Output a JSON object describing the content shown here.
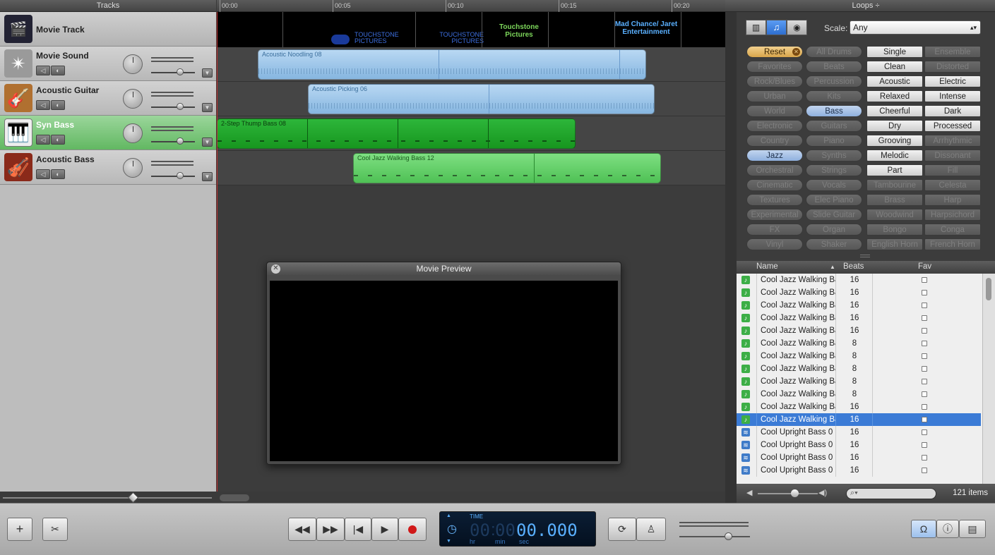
{
  "headers": {
    "tracks": "Tracks",
    "loops": "Loops ÷"
  },
  "ruler": [
    "00:00",
    "00:05",
    "00:10",
    "00:15",
    "00:20"
  ],
  "tracks": [
    {
      "name": "Movie Track",
      "icon": "clapper-icon"
    },
    {
      "name": "Movie Sound",
      "icon": "sound-icon"
    },
    {
      "name": "Acoustic Guitar",
      "icon": "guitar-icon"
    },
    {
      "name": "Syn Bass",
      "icon": "synth-icon"
    },
    {
      "name": "Acoustic Bass",
      "icon": "bass-icon"
    }
  ],
  "movie_frames": [
    "TOUCHSTONE PICTURES",
    "TOUCHSTONE PICTURES",
    "Touchstone Pictures",
    "Mad Chance/ Jaret Entertainment"
  ],
  "regions": [
    {
      "name": "Acoustic Noodling 08"
    },
    {
      "name": "Acoustic Picking 06"
    },
    {
      "name": "2-Step Thump Bass 08"
    },
    {
      "name": "Cool Jazz Walking Bass 12"
    }
  ],
  "preview": {
    "title": "Movie Preview"
  },
  "loops": {
    "scale_label": "Scale:",
    "scale_value": "Any",
    "grid": [
      [
        "Reset",
        "All Drums",
        "Single",
        "Ensemble"
      ],
      [
        "Favorites",
        "Beats",
        "Clean",
        "Distorted"
      ],
      [
        "Rock/Blues",
        "Percussion",
        "Acoustic",
        "Electric"
      ],
      [
        "Urban",
        "Kits",
        "Relaxed",
        "Intense"
      ],
      [
        "World",
        "Bass",
        "Cheerful",
        "Dark"
      ],
      [
        "Electronic",
        "Guitars",
        "Dry",
        "Processed"
      ],
      [
        "Country",
        "Piano",
        "Grooving",
        "Arrhythmic"
      ],
      [
        "Jazz",
        "Synths",
        "Melodic",
        "Dissonant"
      ],
      [
        "Orchestral",
        "Strings",
        "Part",
        "Fill"
      ],
      [
        "Cinematic",
        "Vocals",
        "Tambourine",
        "Celesta"
      ],
      [
        "Textures",
        "Elec Piano",
        "Brass",
        "Harp"
      ],
      [
        "Experimental",
        "Slide Guitar",
        "Woodwind",
        "Harpsichord"
      ],
      [
        "FX",
        "Organ",
        "Bongo",
        "Conga"
      ],
      [
        "Vinyl",
        "Shaker",
        "English Horn",
        "French Horn"
      ]
    ]
  },
  "results": {
    "columns": {
      "name": "Name",
      "beats": "Beats",
      "fav": "Fav"
    },
    "rows": [
      {
        "name": "Cool Jazz Walking Ba",
        "beats": "16",
        "type": "midi"
      },
      {
        "name": "Cool Jazz Walking Ba",
        "beats": "16",
        "type": "midi"
      },
      {
        "name": "Cool Jazz Walking Ba",
        "beats": "16",
        "type": "midi"
      },
      {
        "name": "Cool Jazz Walking Ba",
        "beats": "16",
        "type": "midi"
      },
      {
        "name": "Cool Jazz Walking Ba",
        "beats": "16",
        "type": "midi"
      },
      {
        "name": "Cool Jazz Walking Ba",
        "beats": "8",
        "type": "midi"
      },
      {
        "name": "Cool Jazz Walking Ba",
        "beats": "8",
        "type": "midi"
      },
      {
        "name": "Cool Jazz Walking Ba",
        "beats": "8",
        "type": "midi"
      },
      {
        "name": "Cool Jazz Walking Ba",
        "beats": "8",
        "type": "midi"
      },
      {
        "name": "Cool Jazz Walking Ba",
        "beats": "8",
        "type": "midi"
      },
      {
        "name": "Cool Jazz Walking Ba",
        "beats": "16",
        "type": "midi"
      },
      {
        "name": "Cool Jazz Walking Ba",
        "beats": "16",
        "type": "midi",
        "selected": true
      },
      {
        "name": "Cool Upright Bass 0",
        "beats": "16",
        "type": "audio"
      },
      {
        "name": "Cool Upright Bass 0",
        "beats": "16",
        "type": "audio"
      },
      {
        "name": "Cool Upright Bass 0",
        "beats": "16",
        "type": "audio"
      },
      {
        "name": "Cool Upright Bass 0",
        "beats": "16",
        "type": "audio"
      }
    ],
    "count": "121 items"
  },
  "transport": {
    "lcd_label": "TIME",
    "hr": "00",
    "min": "00",
    "sec": "00.000",
    "hr_label": "hr",
    "min_label": "min",
    "sec_label": "sec"
  },
  "colors": {
    "selected_track": "#62b862",
    "selected_row": "#3b7bd6",
    "reset": "#d8a54b"
  }
}
